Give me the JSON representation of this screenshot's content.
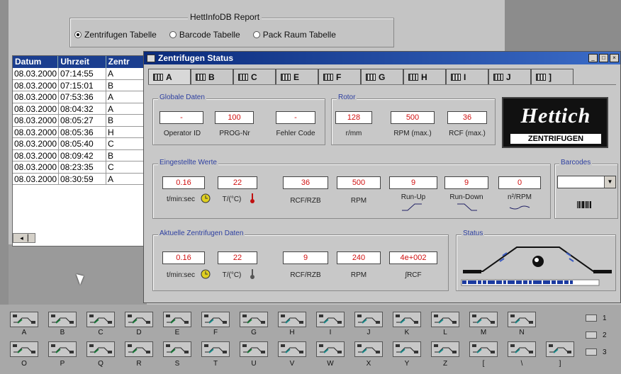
{
  "report": {
    "title": "HettInfoDB  Report",
    "options": [
      "Zentrifugen Tabelle",
      "Barcode Tabelle",
      "Pack Raum Tabelle"
    ],
    "selected": 0
  },
  "table": {
    "headers": [
      "Datum",
      "Uhrzeit",
      "Zentr"
    ],
    "rows": [
      [
        "08.03.2000",
        "07:14:55",
        "A"
      ],
      [
        "08.03.2000",
        "07:15:01",
        "B"
      ],
      [
        "08.03.2000",
        "07:53:36",
        "A"
      ],
      [
        "08.03.2000",
        "08:04:32",
        "A"
      ],
      [
        "08.03.2000",
        "08:05:27",
        "B"
      ],
      [
        "08.03.2000",
        "08:05:36",
        "H"
      ],
      [
        "08.03.2000",
        "08:05:40",
        "C"
      ],
      [
        "08.03.2000",
        "08:09:42",
        "B"
      ],
      [
        "08.03.2000",
        "08:23:35",
        "C"
      ],
      [
        "08.03.2000",
        "08:30:59",
        "A"
      ]
    ]
  },
  "window": {
    "title": "Zentrifugen Status",
    "tabs": [
      "A",
      "B",
      "C",
      "E",
      "F",
      "G",
      "H",
      "I",
      "J",
      "]"
    ],
    "active_tab": 0,
    "globale": {
      "label": "Globale Daten",
      "fields": [
        {
          "value": "-",
          "label": "Operator ID"
        },
        {
          "value": "100",
          "label": "PROG-Nr"
        },
        {
          "value": "-",
          "label": "Fehler Code"
        }
      ]
    },
    "rotor": {
      "label": "Rotor",
      "fields": [
        {
          "value": "128",
          "label": "r/mm"
        },
        {
          "value": "500",
          "label": "RPM (max.)"
        },
        {
          "value": "36",
          "label": "RCF (max.)"
        }
      ]
    },
    "logo": {
      "top": "Hettich",
      "bottom": "ZENTRIFUGEN"
    },
    "eingestellte": {
      "label": "Eingestellte  Werte",
      "fields": [
        {
          "value": "0.16",
          "label": "t/min:sec"
        },
        {
          "value": "22",
          "label": "T/(°C)"
        },
        {
          "value": "36",
          "label": "RCF/RZB"
        },
        {
          "value": "500",
          "label": "RPM"
        },
        {
          "value": "9",
          "label": "Run-Up"
        },
        {
          "value": "9",
          "label": "Run-Down"
        },
        {
          "value": "0",
          "label": "n²/RPM"
        }
      ]
    },
    "barcodes": {
      "label": "Barcodes"
    },
    "aktuelle": {
      "label": "Aktuelle Zentrifugen Daten",
      "fields": [
        {
          "value": "0.16",
          "label": "t/min:sec"
        },
        {
          "value": "22",
          "label": "T/(°C)"
        },
        {
          "value": "9",
          "label": "RCF/RZB"
        },
        {
          "value": "240",
          "label": "RPM"
        },
        {
          "value": "4e+002",
          "label": "∫RCF"
        }
      ]
    },
    "status": {
      "label": "Status"
    }
  },
  "bottom": {
    "row1": [
      "A",
      "B",
      "C",
      "D",
      "E",
      "F",
      "G",
      "H",
      "I",
      "J",
      "K",
      "L",
      "M",
      "N"
    ],
    "row2": [
      "O",
      "P",
      "Q",
      "R",
      "S",
      "T",
      "U",
      "V",
      "W",
      "X",
      "Y",
      "Z",
      "[",
      "\\",
      "]"
    ],
    "side": [
      "1",
      "2",
      "3"
    ]
  },
  "colors": {
    "value_red": "#d01010",
    "titlebar": "#0a2a7a",
    "table_head": "#1b3e8f",
    "progress": "#1a3aa0"
  }
}
